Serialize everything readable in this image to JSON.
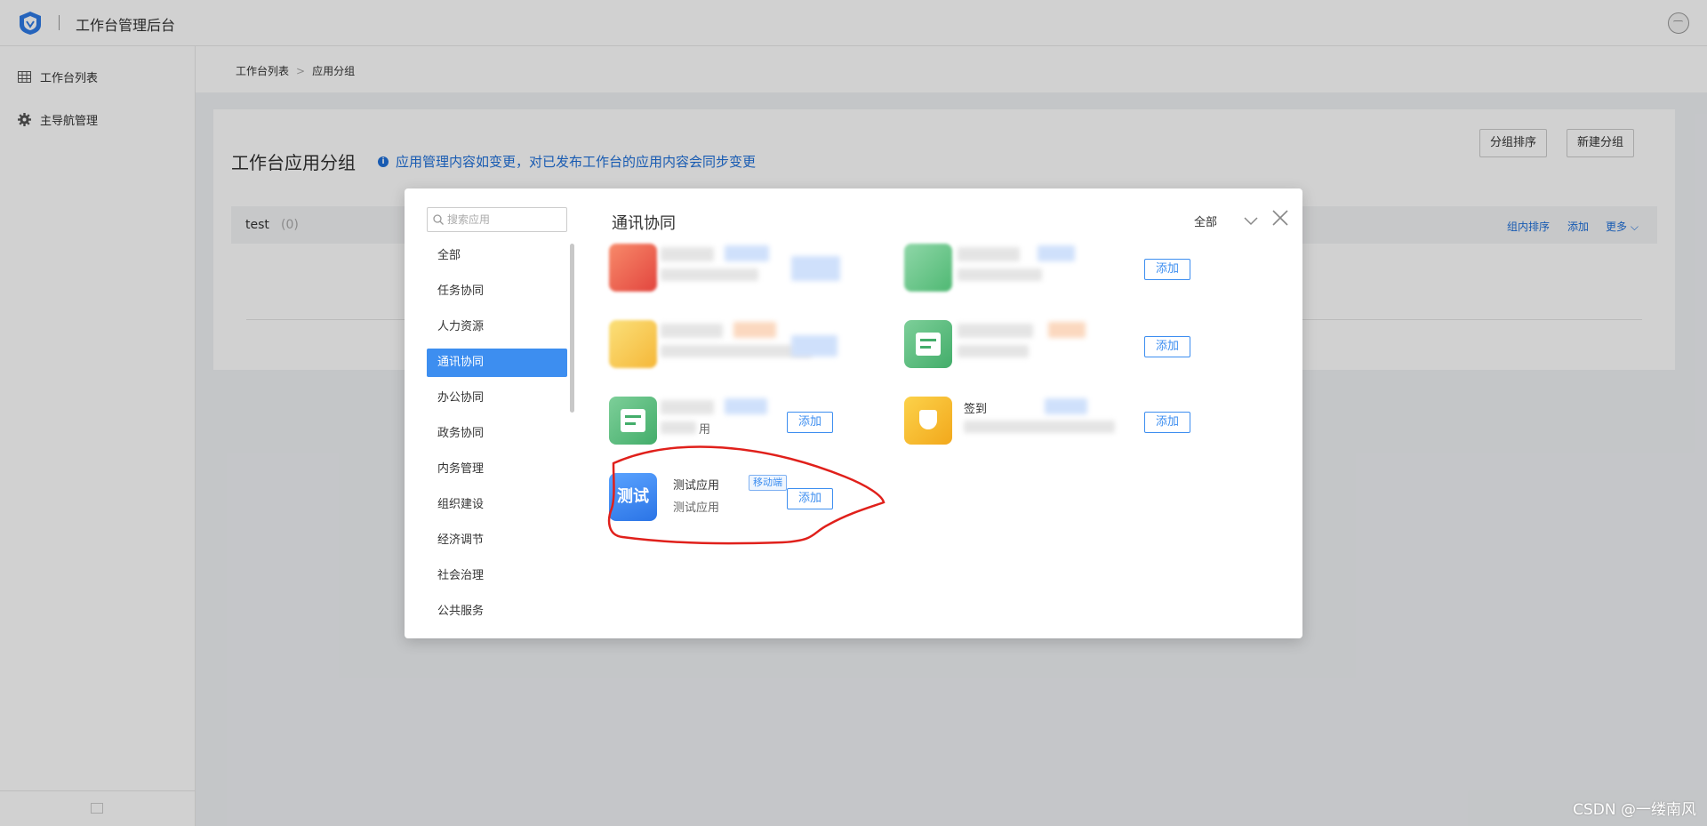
{
  "header": {
    "app_title": "工作台管理后台"
  },
  "sidebar": {
    "items": [
      {
        "label": "工作台列表",
        "icon": "grid-icon"
      },
      {
        "label": "主导航管理",
        "icon": "gear-icon"
      }
    ]
  },
  "breadcrumb": [
    "工作台列表",
    "应用分组"
  ],
  "main": {
    "title": "工作台应用分组",
    "notice": "应用管理内容如变更，对已发布工作台的应用内容会同步变更",
    "buttons": {
      "sort": "分组排序",
      "new_group": "新建分组"
    },
    "group": {
      "name": "test",
      "count": "(0)",
      "actions": {
        "sort": "组内排序",
        "add": "添加",
        "more": "更多"
      }
    }
  },
  "modal": {
    "search_placeholder": "搜索应用",
    "categories": [
      "全部",
      "任务协同",
      "人力资源",
      "通讯协同",
      "办公协同",
      "政务协同",
      "内务管理",
      "组织建设",
      "经济调节",
      "社会治理",
      "公共服务"
    ],
    "active_category": "通讯协同",
    "section_title": "通讯协同",
    "filter_label": "全部",
    "add_label": "添加",
    "visible_fragments": {
      "a": "签到",
      "b": "用"
    },
    "test_app": {
      "icon_text": "测试",
      "name": "测试应用",
      "desc": "测试应用",
      "tag": "移动端"
    }
  },
  "colors": {
    "accent": "#3d8ef0",
    "notice": "#1e6fd9",
    "annotation": "#e0201b"
  },
  "watermark": "CSDN @一缕南风"
}
